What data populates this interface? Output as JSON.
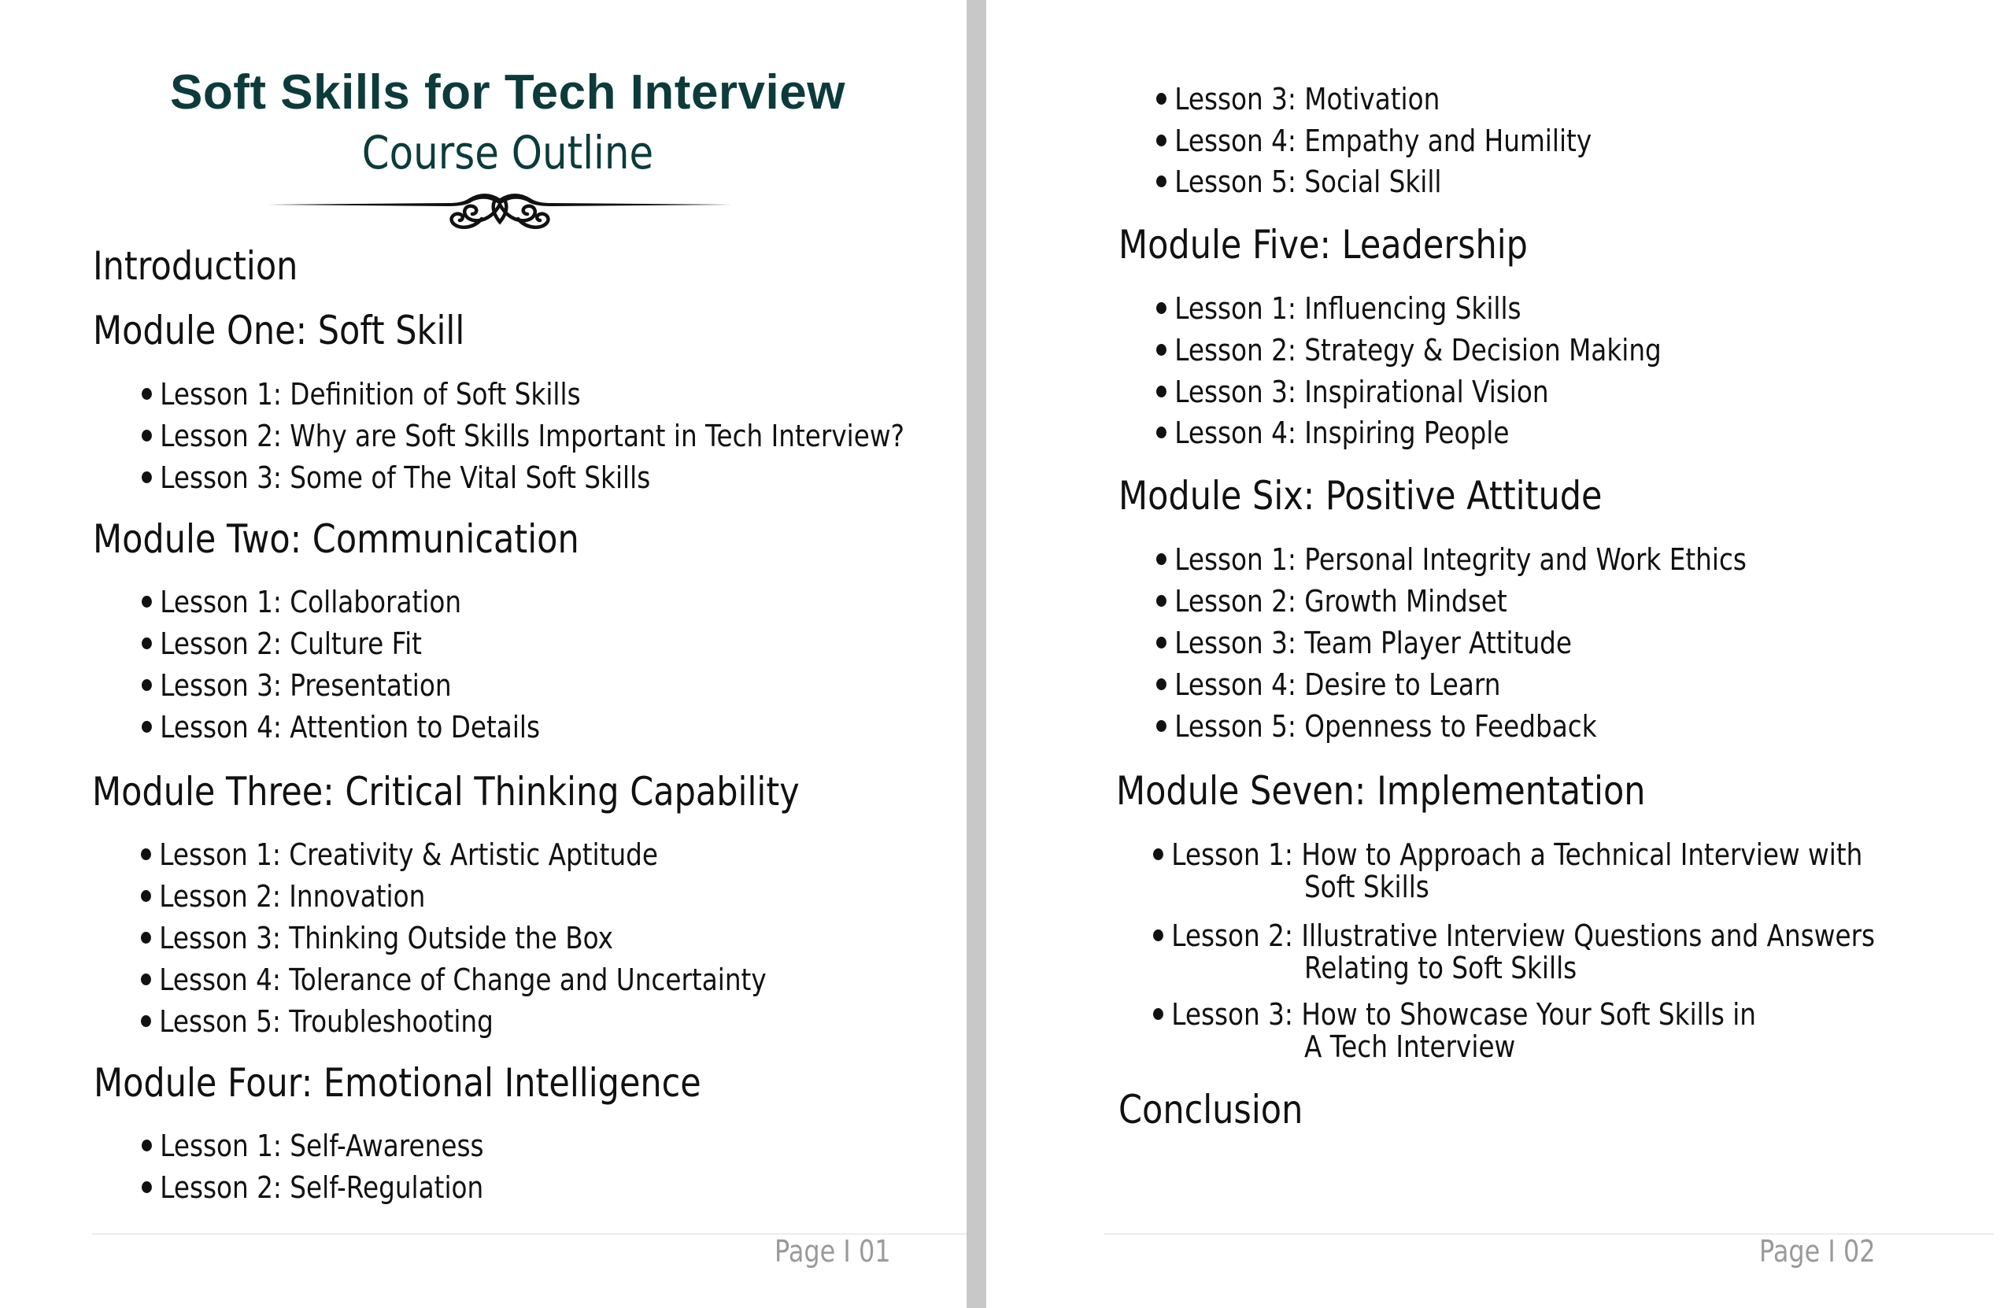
{
  "document": {
    "title": "Soft Skills for Tech Interview",
    "subtitle": "Course Outline",
    "colors": {
      "title": "#0d3b3b",
      "text": "#111111",
      "page_number": "#9a9a9a",
      "gutter": "#c8c8c8"
    },
    "ornament_icon": "flourish-divider-icon"
  },
  "pages": [
    {
      "page_label": "Page I 01",
      "sections": [
        {
          "heading": "Introduction",
          "lessons": []
        },
        {
          "heading": "Module One: Soft Skill",
          "lessons": [
            "Lesson 1: Definition of Soft Skills",
            "Lesson 2: Why are Soft Skills Important in Tech Interview?",
            "Lesson 3: Some of The Vital Soft Skills"
          ]
        },
        {
          "heading": "Module Two: Communication",
          "lessons": [
            "Lesson 1: Collaboration",
            "Lesson 2: Culture Fit",
            "Lesson 3: Presentation",
            "Lesson 4: Attention to Details"
          ]
        },
        {
          "heading": "Module Three: Critical Thinking Capability",
          "lessons": [
            "Lesson 1: Creativity & Artistic Aptitude",
            "Lesson 2: Innovation",
            "Lesson 3: Thinking Outside the Box",
            "Lesson 4: Tolerance of Change and Uncertainty",
            "Lesson 5: Troubleshooting"
          ]
        },
        {
          "heading": "Module Four: Emotional Intelligence",
          "lessons": [
            "Lesson 1: Self-Awareness",
            "Lesson 2: Self-Regulation"
          ]
        }
      ]
    },
    {
      "page_label": "Page I 02",
      "continued_lessons": [
        "Lesson 3: Motivation",
        "Lesson 4: Empathy and Humility",
        "Lesson 5: Social Skill"
      ],
      "sections": [
        {
          "heading": "Module Five: Leadership",
          "lessons": [
            "Lesson 1: Influencing Skills",
            "Lesson 2: Strategy & Decision Making",
            "Lesson 3: Inspirational Vision",
            "Lesson 4: Inspiring People"
          ]
        },
        {
          "heading": "Module Six: Positive Attitude",
          "lessons": [
            "Lesson 1: Personal Integrity and Work Ethics",
            "Lesson 2: Growth Mindset",
            "Lesson 3: Team Player Attitude",
            "Lesson 4: Desire to Learn",
            "Lesson 5: Openness to Feedback"
          ]
        },
        {
          "heading": "Module Seven: Implementation",
          "lessons": [
            {
              "prefix": "Lesson 1:",
              "line1": "How to Approach a Technical Interview with",
              "line2": "Soft Skills"
            },
            {
              "prefix": "Lesson 2:",
              "line1": "Illustrative Interview Questions and Answers",
              "line2": "Relating to Soft Skills"
            },
            {
              "prefix": "Lesson 3:",
              "line1": "How to Showcase Your Soft Skills in",
              "line2": "A Tech Interview"
            }
          ]
        },
        {
          "heading": "Conclusion",
          "lessons": []
        }
      ]
    }
  ]
}
